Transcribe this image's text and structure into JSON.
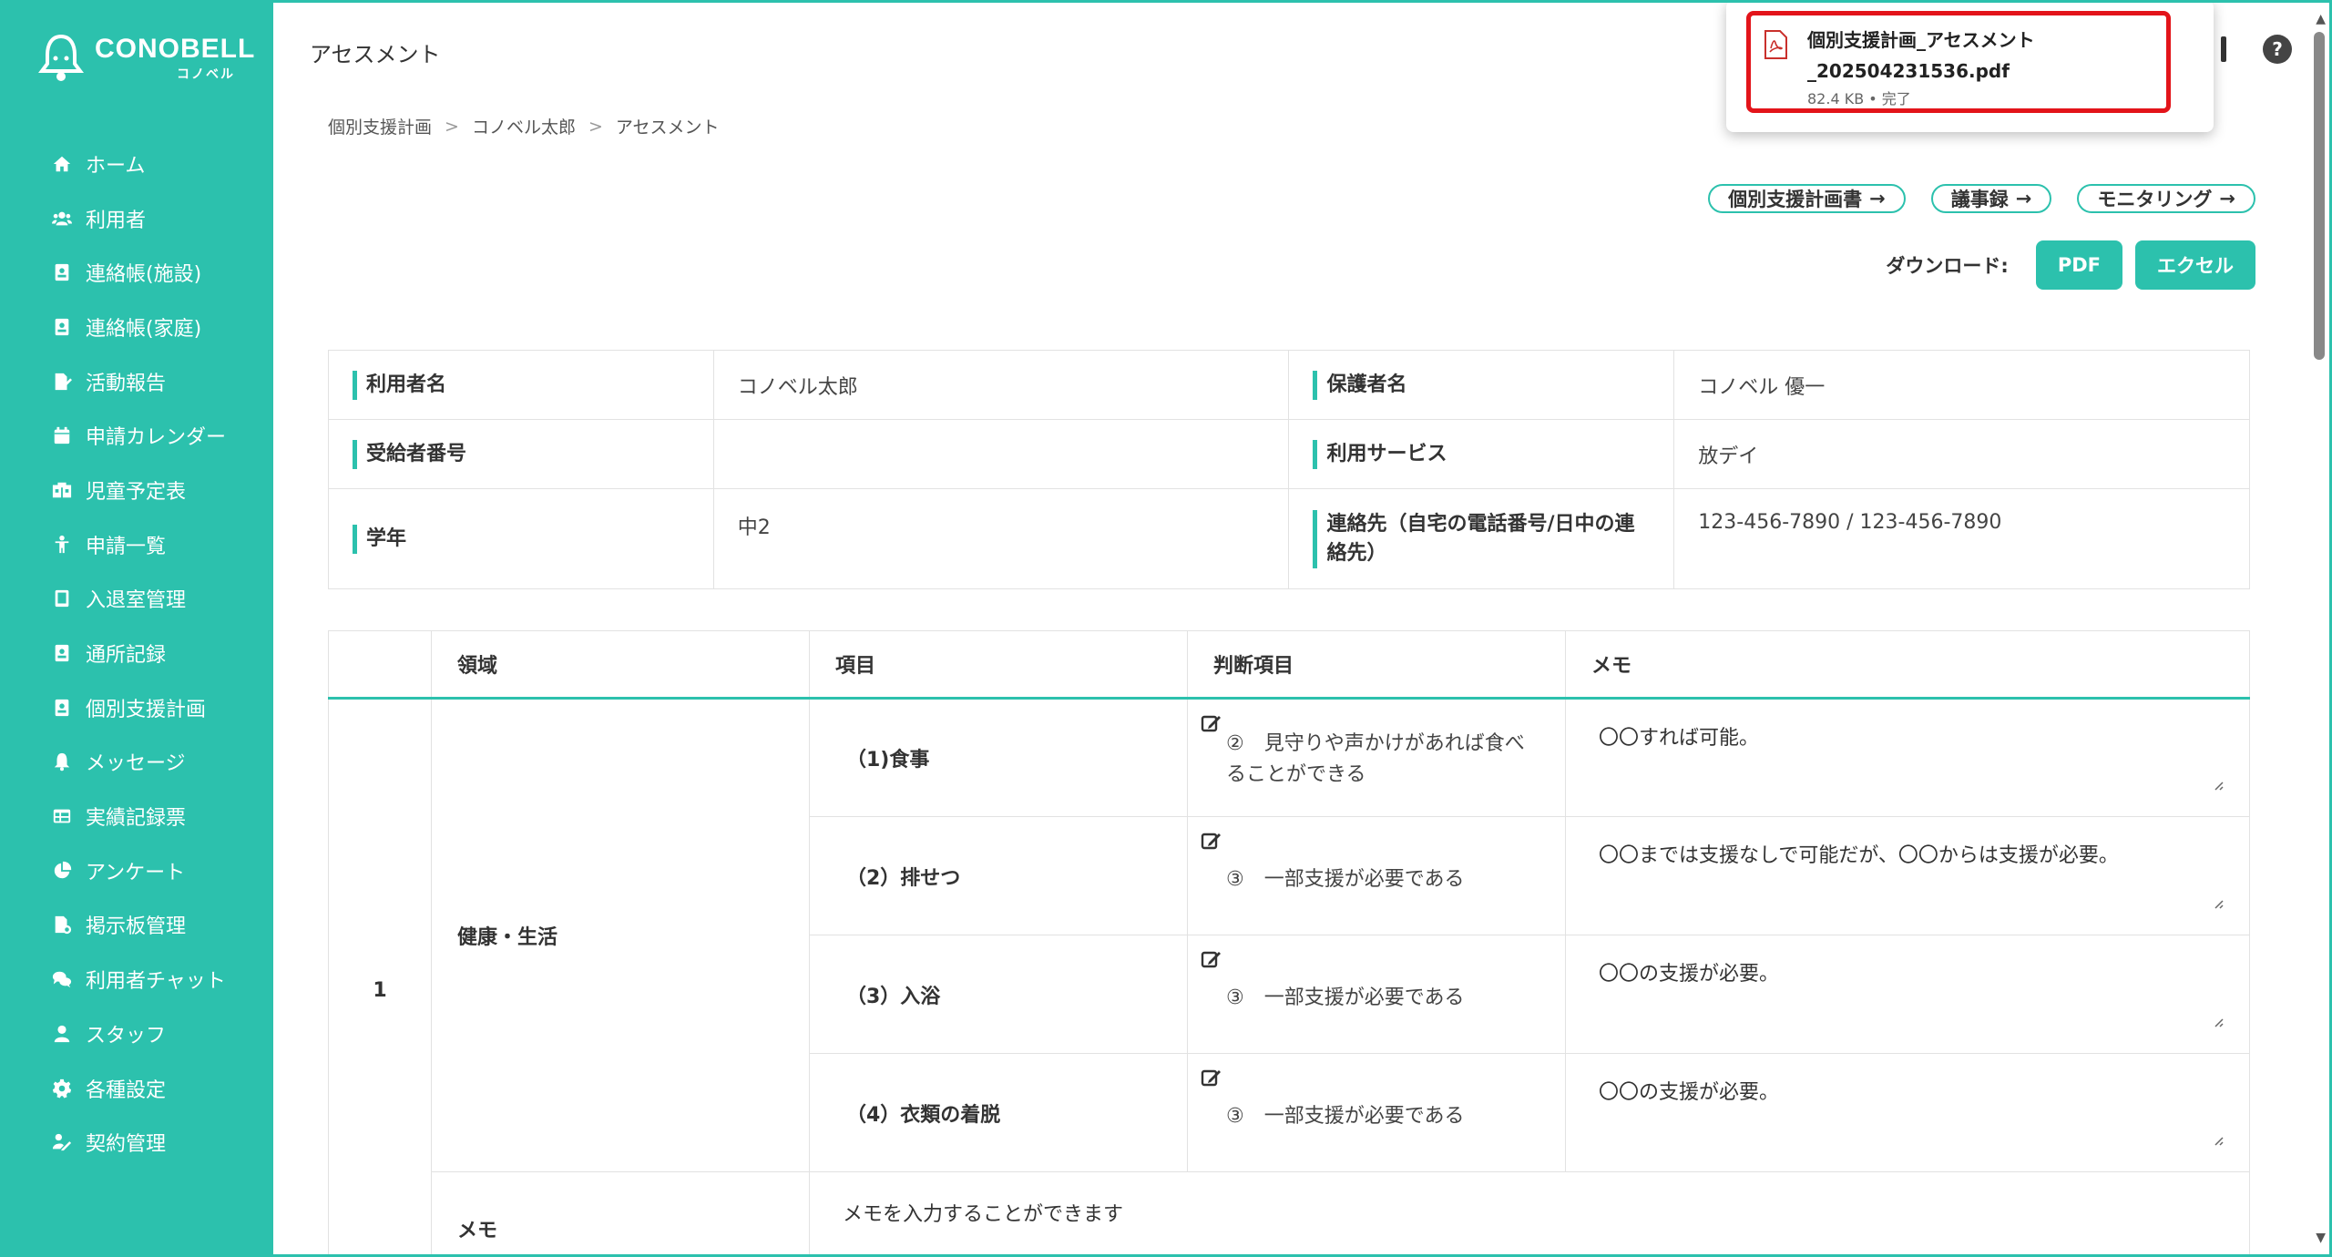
{
  "brand": {
    "name": "CONOBELL",
    "sub": "コノベル",
    "accent": "#2cc1ad"
  },
  "sidebar": {
    "items": [
      {
        "label": "ホーム",
        "icon": "home-icon"
      },
      {
        "label": "利用者",
        "icon": "users-icon"
      },
      {
        "label": "連絡帳(施設)",
        "icon": "contact-book-icon"
      },
      {
        "label": "連絡帳(家庭)",
        "icon": "contact-book-icon"
      },
      {
        "label": "活動報告",
        "icon": "report-edit-icon"
      },
      {
        "label": "申請カレンダー",
        "icon": "calendar-icon"
      },
      {
        "label": "児童予定表",
        "icon": "schedule-icon"
      },
      {
        "label": "申請一覧",
        "icon": "child-icon"
      },
      {
        "label": "入退室管理",
        "icon": "tablet-icon"
      },
      {
        "label": "通所記録",
        "icon": "record-icon"
      },
      {
        "label": "個別支援計画",
        "icon": "plan-icon"
      },
      {
        "label": "メッセージ",
        "icon": "bell-icon"
      },
      {
        "label": "実績記録票",
        "icon": "table-icon"
      },
      {
        "label": "アンケート",
        "icon": "pie-icon"
      },
      {
        "label": "掲示板管理",
        "icon": "board-icon"
      },
      {
        "label": "利用者チャット",
        "icon": "chat-icon"
      },
      {
        "label": "スタッフ",
        "icon": "staff-icon"
      },
      {
        "label": "各種設定",
        "icon": "gear-icon"
      },
      {
        "label": "契約管理",
        "icon": "contract-icon"
      }
    ]
  },
  "header": {
    "title": "アセスメント",
    "breadcrumb": [
      "個別支援計画",
      "コノベル太郎",
      "アセスメント"
    ]
  },
  "actions": {
    "links": [
      "個別支援計画書",
      "議事録",
      "モニタリング"
    ],
    "download_label": "ダウンロード:",
    "pdf_label": "PDF",
    "excel_label": "エクセル"
  },
  "download_popup": {
    "filename_line1": "個別支援計画_アセスメント",
    "filename_line2": "_202504231536.pdf",
    "meta": "82.4 KB • 完了"
  },
  "info": {
    "user_name_label": "利用者名",
    "user_name": "コノベル太郎",
    "guardian_label": "保護者名",
    "guardian": "コノベル 優一",
    "recipient_no_label": "受給者番号",
    "recipient_no": "",
    "service_label": "利用サービス",
    "service": "放デイ",
    "grade_label": "学年",
    "grade": "中2",
    "contact_label": "連絡先（自宅の電話番号/日中の連絡先）",
    "contact": "123-456-7890 / 123-456-7890"
  },
  "assessment": {
    "headers": [
      "",
      "領域",
      "項目",
      "判断項目",
      "メモ"
    ],
    "number": "1",
    "area": "健康・生活",
    "rows": [
      {
        "item": "（1)食事",
        "judgement": "②　見守りや声かけがあれば食べることができる",
        "memo": "〇〇すれば可能。"
      },
      {
        "item": "（2）排せつ",
        "judgement": "③　一部支援が必要である",
        "memo": "〇〇までは支援なしで可能だが、〇〇からは支援が必要。"
      },
      {
        "item": "（3）入浴",
        "judgement": "③　一部支援が必要である",
        "memo": "〇〇の支援が必要。"
      },
      {
        "item": "（4）衣類の着脱",
        "judgement": "③　一部支援が必要である",
        "memo": "〇〇の支援が必要。"
      }
    ],
    "memo_label": "メモ",
    "memo_placeholder": "メモを入力することができます"
  }
}
